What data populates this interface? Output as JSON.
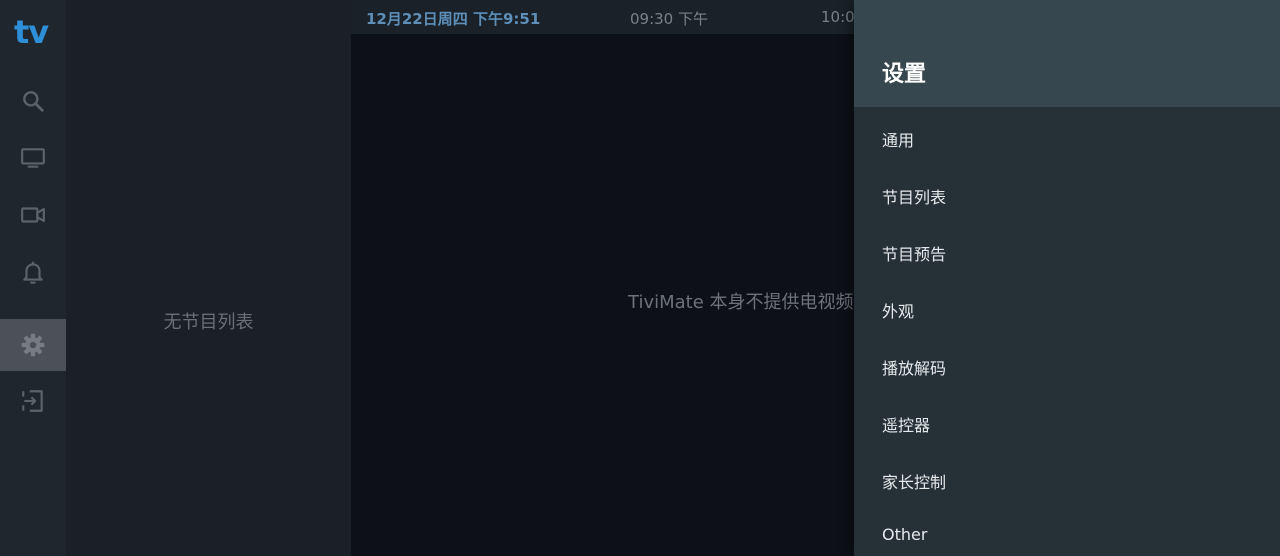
{
  "app": {
    "logo_text": "tv",
    "brand_color": "#2e8fd8"
  },
  "nav": [
    {
      "id": "search",
      "icon": "search-icon",
      "active": false
    },
    {
      "id": "tv",
      "icon": "tv-icon",
      "active": false
    },
    {
      "id": "recordings",
      "icon": "video-camera-icon",
      "active": false
    },
    {
      "id": "reminders",
      "icon": "bell-icon",
      "active": false
    },
    {
      "id": "settings",
      "icon": "gear-icon",
      "active": true
    },
    {
      "id": "exit",
      "icon": "exit-icon",
      "active": false
    }
  ],
  "playlist": {
    "empty_text": "无节目列表"
  },
  "guide": {
    "date_time": "12月22日周四 下午9:51",
    "slots": [
      "09:30 下午",
      "10:0"
    ],
    "message": "TiviMate 本身不提供电视频"
  },
  "settings": {
    "title": "设置",
    "items": [
      {
        "label": "通用"
      },
      {
        "label": "节目列表"
      },
      {
        "label": "节目预告"
      },
      {
        "label": "外观"
      },
      {
        "label": "播放解码"
      },
      {
        "label": "遥控器"
      },
      {
        "label": "家长控制"
      },
      {
        "label": "Other"
      }
    ]
  }
}
